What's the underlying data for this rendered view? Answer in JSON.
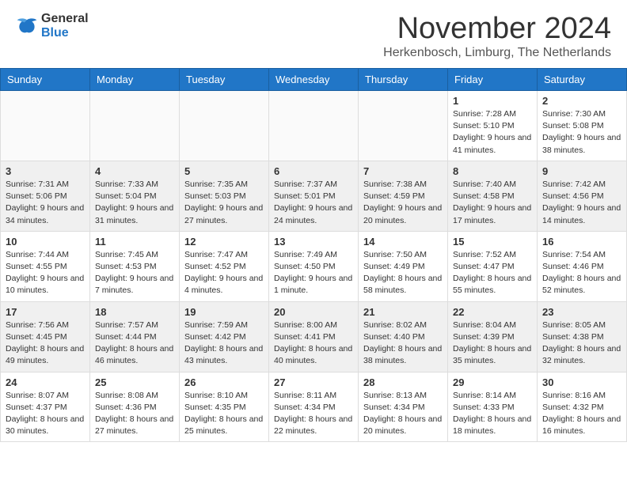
{
  "header": {
    "logo_general": "General",
    "logo_blue": "Blue",
    "month_title": "November 2024",
    "subtitle": "Herkenbosch, Limburg, The Netherlands"
  },
  "days_of_week": [
    "Sunday",
    "Monday",
    "Tuesday",
    "Wednesday",
    "Thursday",
    "Friday",
    "Saturday"
  ],
  "weeks": [
    [
      {
        "day": "",
        "info": ""
      },
      {
        "day": "",
        "info": ""
      },
      {
        "day": "",
        "info": ""
      },
      {
        "day": "",
        "info": ""
      },
      {
        "day": "",
        "info": ""
      },
      {
        "day": "1",
        "info": "Sunrise: 7:28 AM\nSunset: 5:10 PM\nDaylight: 9 hours and 41 minutes."
      },
      {
        "day": "2",
        "info": "Sunrise: 7:30 AM\nSunset: 5:08 PM\nDaylight: 9 hours and 38 minutes."
      }
    ],
    [
      {
        "day": "3",
        "info": "Sunrise: 7:31 AM\nSunset: 5:06 PM\nDaylight: 9 hours and 34 minutes."
      },
      {
        "day": "4",
        "info": "Sunrise: 7:33 AM\nSunset: 5:04 PM\nDaylight: 9 hours and 31 minutes."
      },
      {
        "day": "5",
        "info": "Sunrise: 7:35 AM\nSunset: 5:03 PM\nDaylight: 9 hours and 27 minutes."
      },
      {
        "day": "6",
        "info": "Sunrise: 7:37 AM\nSunset: 5:01 PM\nDaylight: 9 hours and 24 minutes."
      },
      {
        "day": "7",
        "info": "Sunrise: 7:38 AM\nSunset: 4:59 PM\nDaylight: 9 hours and 20 minutes."
      },
      {
        "day": "8",
        "info": "Sunrise: 7:40 AM\nSunset: 4:58 PM\nDaylight: 9 hours and 17 minutes."
      },
      {
        "day": "9",
        "info": "Sunrise: 7:42 AM\nSunset: 4:56 PM\nDaylight: 9 hours and 14 minutes."
      }
    ],
    [
      {
        "day": "10",
        "info": "Sunrise: 7:44 AM\nSunset: 4:55 PM\nDaylight: 9 hours and 10 minutes."
      },
      {
        "day": "11",
        "info": "Sunrise: 7:45 AM\nSunset: 4:53 PM\nDaylight: 9 hours and 7 minutes."
      },
      {
        "day": "12",
        "info": "Sunrise: 7:47 AM\nSunset: 4:52 PM\nDaylight: 9 hours and 4 minutes."
      },
      {
        "day": "13",
        "info": "Sunrise: 7:49 AM\nSunset: 4:50 PM\nDaylight: 9 hours and 1 minute."
      },
      {
        "day": "14",
        "info": "Sunrise: 7:50 AM\nSunset: 4:49 PM\nDaylight: 8 hours and 58 minutes."
      },
      {
        "day": "15",
        "info": "Sunrise: 7:52 AM\nSunset: 4:47 PM\nDaylight: 8 hours and 55 minutes."
      },
      {
        "day": "16",
        "info": "Sunrise: 7:54 AM\nSunset: 4:46 PM\nDaylight: 8 hours and 52 minutes."
      }
    ],
    [
      {
        "day": "17",
        "info": "Sunrise: 7:56 AM\nSunset: 4:45 PM\nDaylight: 8 hours and 49 minutes."
      },
      {
        "day": "18",
        "info": "Sunrise: 7:57 AM\nSunset: 4:44 PM\nDaylight: 8 hours and 46 minutes."
      },
      {
        "day": "19",
        "info": "Sunrise: 7:59 AM\nSunset: 4:42 PM\nDaylight: 8 hours and 43 minutes."
      },
      {
        "day": "20",
        "info": "Sunrise: 8:00 AM\nSunset: 4:41 PM\nDaylight: 8 hours and 40 minutes."
      },
      {
        "day": "21",
        "info": "Sunrise: 8:02 AM\nSunset: 4:40 PM\nDaylight: 8 hours and 38 minutes."
      },
      {
        "day": "22",
        "info": "Sunrise: 8:04 AM\nSunset: 4:39 PM\nDaylight: 8 hours and 35 minutes."
      },
      {
        "day": "23",
        "info": "Sunrise: 8:05 AM\nSunset: 4:38 PM\nDaylight: 8 hours and 32 minutes."
      }
    ],
    [
      {
        "day": "24",
        "info": "Sunrise: 8:07 AM\nSunset: 4:37 PM\nDaylight: 8 hours and 30 minutes."
      },
      {
        "day": "25",
        "info": "Sunrise: 8:08 AM\nSunset: 4:36 PM\nDaylight: 8 hours and 27 minutes."
      },
      {
        "day": "26",
        "info": "Sunrise: 8:10 AM\nSunset: 4:35 PM\nDaylight: 8 hours and 25 minutes."
      },
      {
        "day": "27",
        "info": "Sunrise: 8:11 AM\nSunset: 4:34 PM\nDaylight: 8 hours and 22 minutes."
      },
      {
        "day": "28",
        "info": "Sunrise: 8:13 AM\nSunset: 4:34 PM\nDaylight: 8 hours and 20 minutes."
      },
      {
        "day": "29",
        "info": "Sunrise: 8:14 AM\nSunset: 4:33 PM\nDaylight: 8 hours and 18 minutes."
      },
      {
        "day": "30",
        "info": "Sunrise: 8:16 AM\nSunset: 4:32 PM\nDaylight: 8 hours and 16 minutes."
      }
    ]
  ]
}
